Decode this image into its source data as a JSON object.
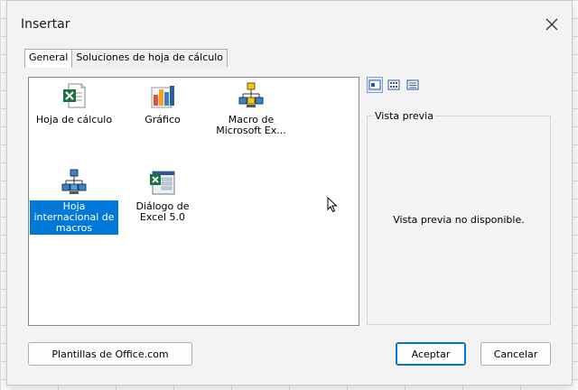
{
  "dialog": {
    "title": "Insertar",
    "close_icon": "close-icon"
  },
  "tabs": [
    {
      "label": "General",
      "active": true
    },
    {
      "label": "Soluciones de hoja de cálculo",
      "active": false
    }
  ],
  "items": [
    {
      "label": "Hoja de cálculo",
      "icon": "excel-worksheet-icon",
      "selected": false
    },
    {
      "label": "Gráfico",
      "icon": "chart-icon",
      "selected": false
    },
    {
      "label": "Macro de Microsoft Ex...",
      "icon": "macro-sheet-icon",
      "selected": false
    },
    {
      "label": "Hoja internacional de macros",
      "icon": "international-macro-icon",
      "selected": true
    },
    {
      "label": "Diálogo de Excel 5.0",
      "icon": "excel-dialog-icon",
      "selected": false
    }
  ],
  "view_buttons": [
    "large-icons-view-icon",
    "list-view-icon",
    "details-view-icon"
  ],
  "preview": {
    "legend": "Vista previa",
    "message": "Vista previa no disponible."
  },
  "buttons": {
    "templates": "Plantillas de Office.com",
    "ok": "Aceptar",
    "cancel": "Cancelar"
  },
  "colors": {
    "selection": "#0078d7",
    "excel_green": "#1e7145"
  }
}
